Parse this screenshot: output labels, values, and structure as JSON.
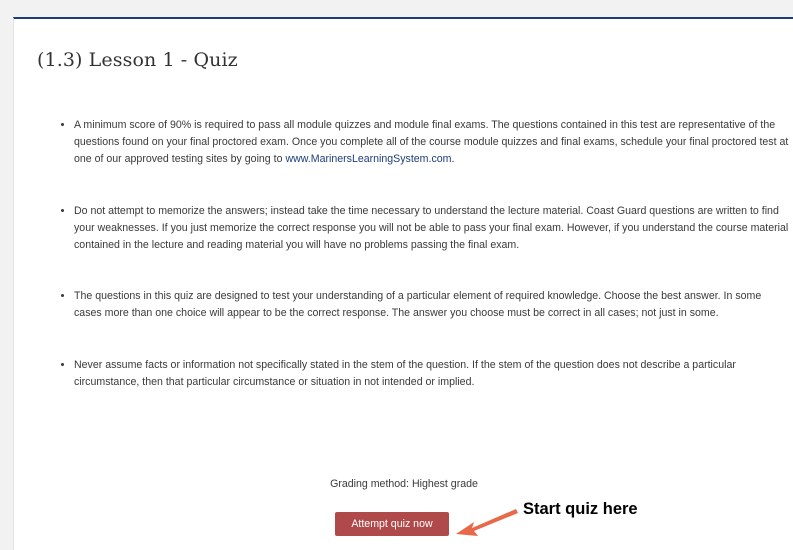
{
  "quiz": {
    "title": "(1.3) Lesson 1 - Quiz",
    "rules": [
      {
        "text": "A minimum score of 90% is required to pass all module quizzes and module final exams. The questions contained in this test are representative of the questions found on your final proctored exam. Once you complete all of the course module quizzes and final exams, schedule your final proctored test at one of our approved testing sites by going to ",
        "link": "www.MarinersLearningSystem.com",
        "after": "."
      },
      {
        "text": "Do not attempt to memorize the answers; instead take the time necessary to understand the lecture material. Coast Guard questions are written to find your weaknesses. If you just memorize the correct response you will not be able to pass your final exam. However, if you understand the course material contained in the lecture and reading material you will have no problems passing the final exam."
      },
      {
        "text": "The questions in this quiz are designed to test your understanding of a particular element of required knowledge. Choose the best answer. In some cases more than one choice will appear to be the correct response. The answer you choose must be correct in all cases; not just in some."
      },
      {
        "text": "Never assume facts or information not specifically stated in the stem of the question. If the stem of the question does not describe a particular circumstance, then that particular circumstance or situation in not intended or implied."
      }
    ],
    "grading_method": "Grading method: Highest grade",
    "attempt_label": "Attempt quiz now",
    "callout": "Start quiz here"
  },
  "colors": {
    "header_border": "#1d3e78",
    "link": "#1d3e78",
    "button": "#b04a4a",
    "arrow": "#e8694a"
  },
  "icons": {
    "callout_arrow": "arrow-pointing-left-icon"
  }
}
